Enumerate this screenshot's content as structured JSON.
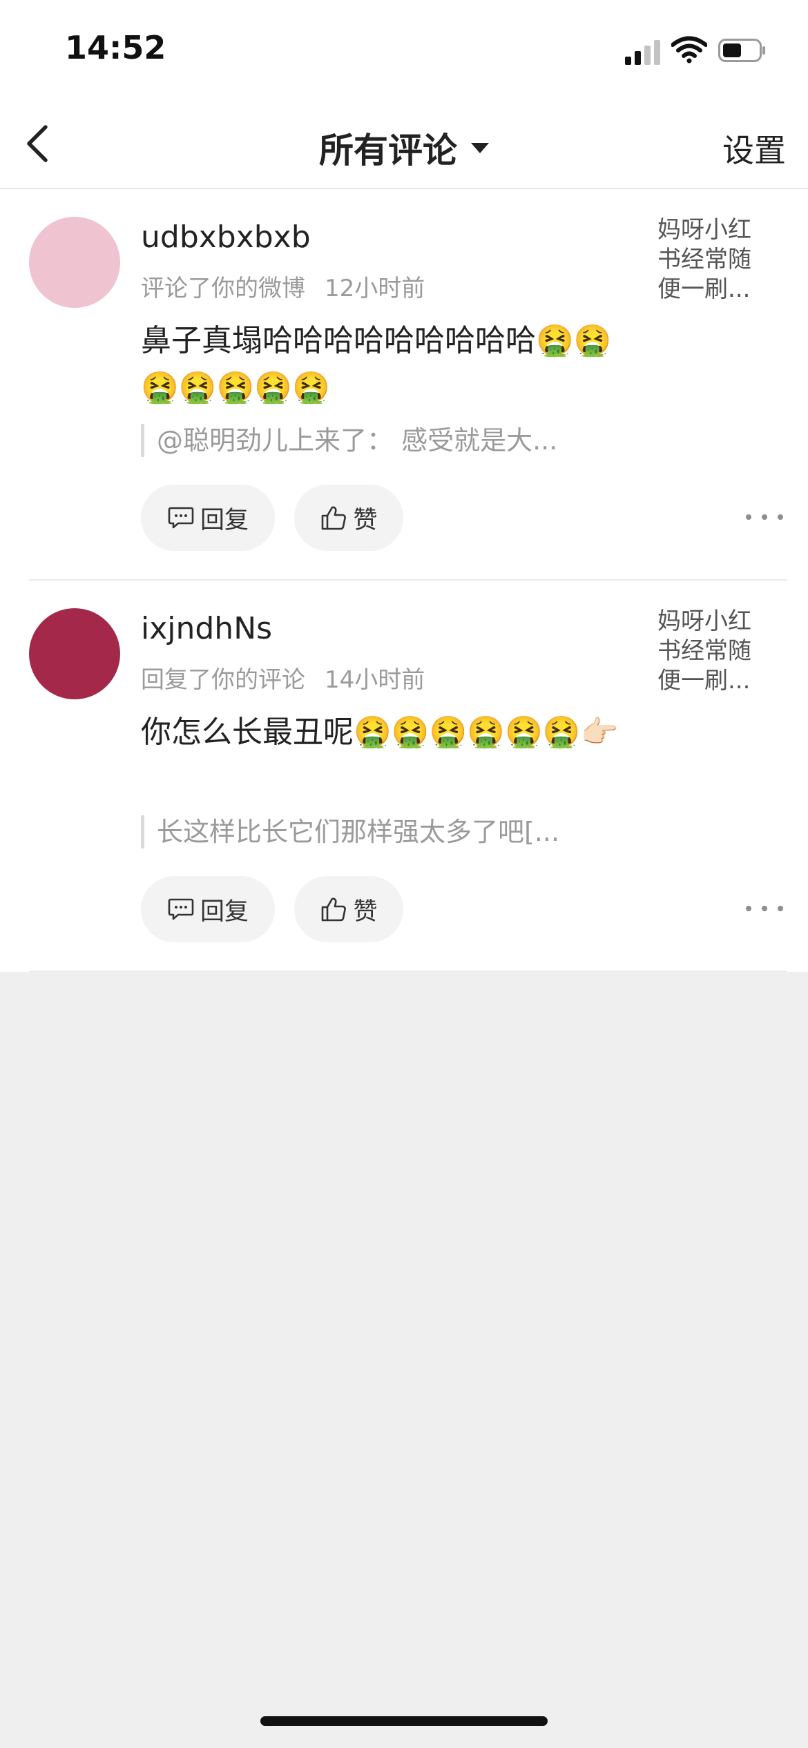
{
  "status_bar": {
    "time": "14:52",
    "icons": [
      "cellular-signal-icon",
      "wifi-icon",
      "battery-icon"
    ]
  },
  "nav": {
    "back_icon": "chevron-left-icon",
    "title": "所有评论",
    "title_dropdown_icon": "caret-down-icon",
    "settings_label": "设置"
  },
  "comments": [
    {
      "username": "udbxbxbxb",
      "avatar_color": "#efc3d0",
      "action": "评论了你的微博",
      "time": "12小时前",
      "content": "鼻子真塌哈哈哈哈哈哈哈哈哈🤮🤮🤮🤮🤮🤮🤮",
      "quote": "@聪明劲儿上来了：  感受就是大...",
      "preview": "妈呀小红书经常随便一刷...",
      "reply_label": "回复",
      "like_label": "赞"
    },
    {
      "username": "ixjndhNs",
      "avatar_color": "#a3284a",
      "action": "回复了你的评论",
      "time": "14小时前",
      "content": "你怎么长最丑呢🤮🤮🤮🤮🤮🤮👉🏻",
      "quote": "长这样比长它们那样强太多了吧[...",
      "preview": "妈呀小红书经常随便一刷...",
      "reply_label": "回复",
      "like_label": "赞"
    }
  ],
  "colors": {
    "background": "#efefef",
    "surface": "#ffffff",
    "secondary_text": "#9a9a9a",
    "button_bg": "#f3f3f3"
  }
}
